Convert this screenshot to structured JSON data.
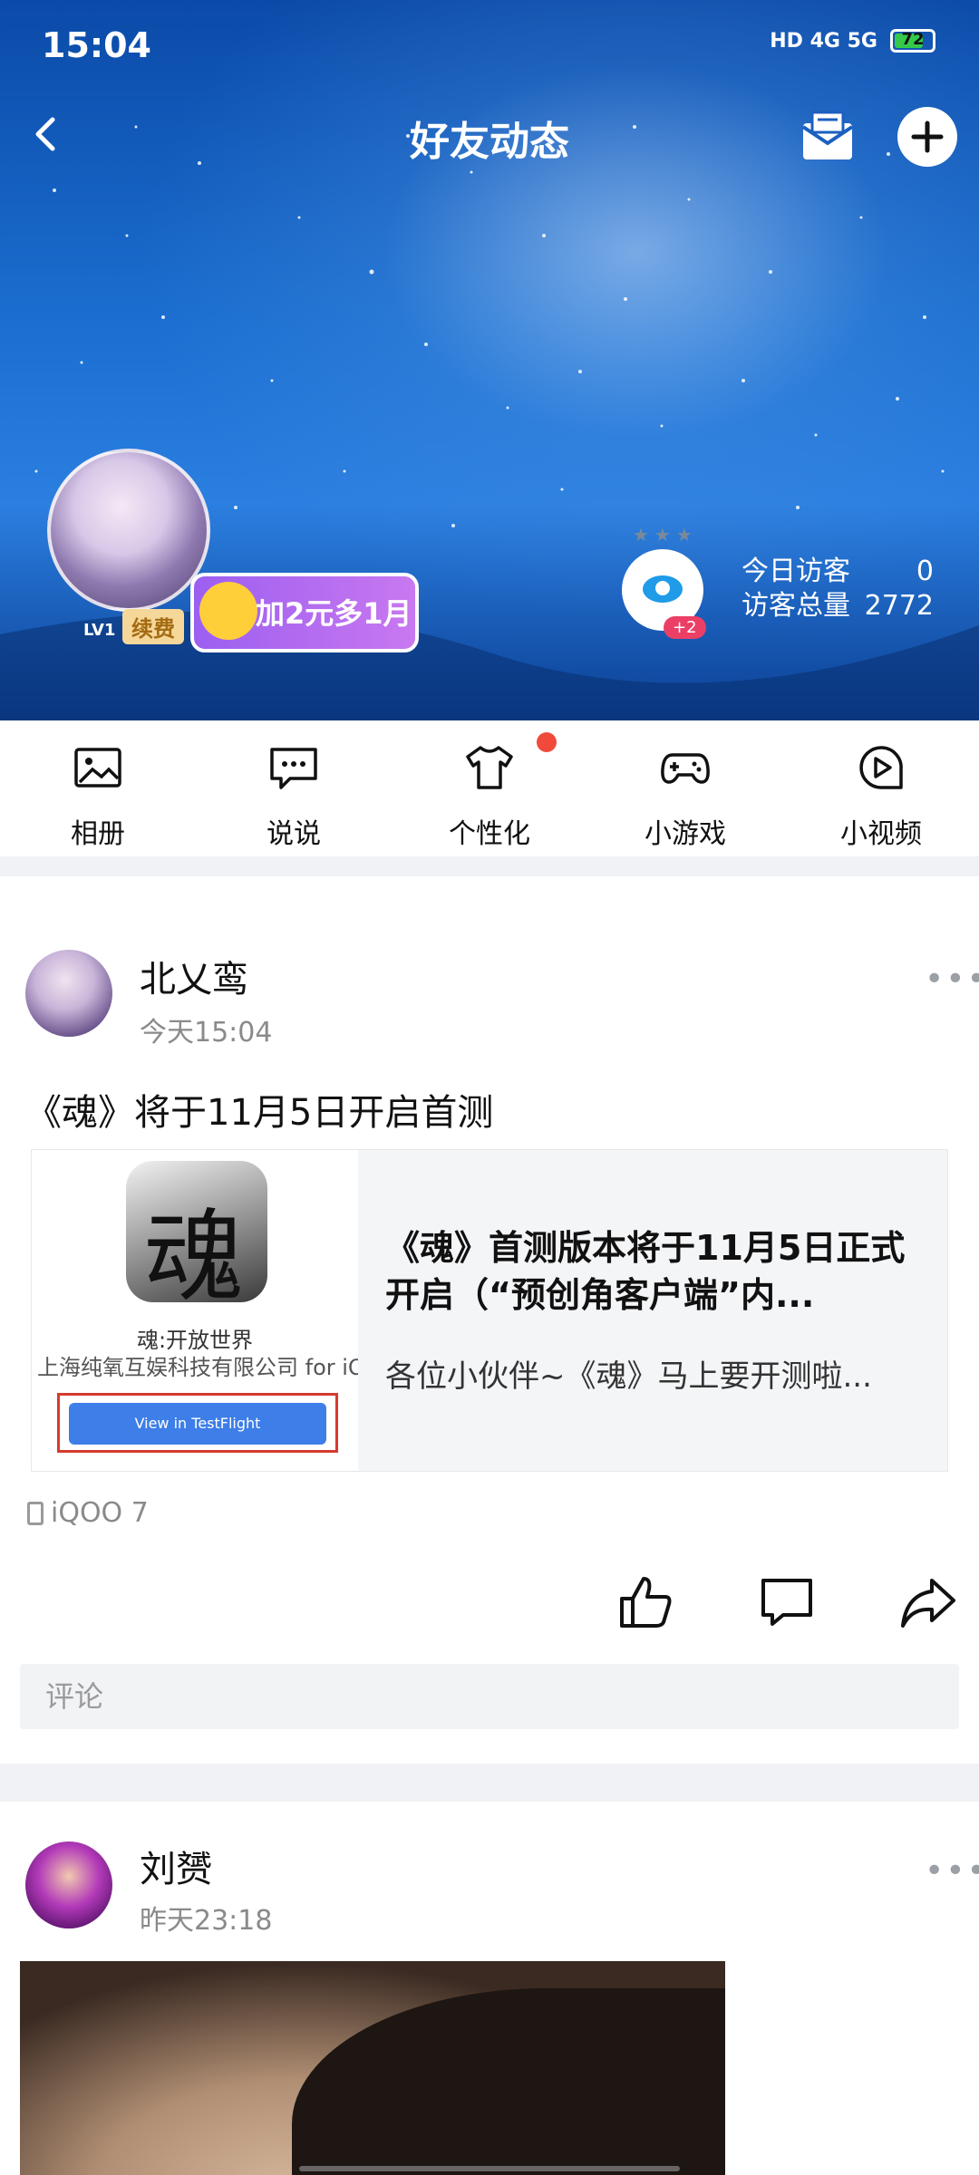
{
  "status_bar": {
    "time": "15:04",
    "network": "HD 4G 5G",
    "battery": "72"
  },
  "header": {
    "title": "好友动态"
  },
  "profile": {
    "level": "LV1",
    "renew_label": "续费",
    "vip_promo": "加2元多1月",
    "visitor_badge": "+2",
    "today_visitors_label": "今日访客",
    "today_visitors": "0",
    "total_visitors_label": "访客总量",
    "total_visitors": "2772"
  },
  "tabs": [
    {
      "label": "相册",
      "icon": "image-icon"
    },
    {
      "label": "说说",
      "icon": "chat-bubble-icon"
    },
    {
      "label": "个性化",
      "icon": "tshirt-icon"
    },
    {
      "label": "小游戏",
      "icon": "gamepad-icon"
    },
    {
      "label": "小视频",
      "icon": "play-circle-icon"
    }
  ],
  "posts": [
    {
      "user": "北乂鸾",
      "time": "今天15:04",
      "text": "《魂》将于11月5日开启首测",
      "card": {
        "app_icon_char": "魂",
        "app_name": "魂:开放世界",
        "app_dev": "上海纯氧互娱科技有限公司 for iOS",
        "button": "View in TestFlight",
        "title": "《魂》首测版本将于11月5日正式开启（“预创角客户端”内...",
        "subtitle": "各位小伙伴~《魂》马上要开测啦..."
      },
      "device": "iQOO 7",
      "comment_placeholder": "评论"
    },
    {
      "user": "刘赟",
      "time": "昨天23:18"
    }
  ],
  "more_label": "•••",
  "colors": {
    "accent": "#3d7ee8",
    "red_dot": "#f04a3a",
    "vip": "#9c5ff0"
  }
}
